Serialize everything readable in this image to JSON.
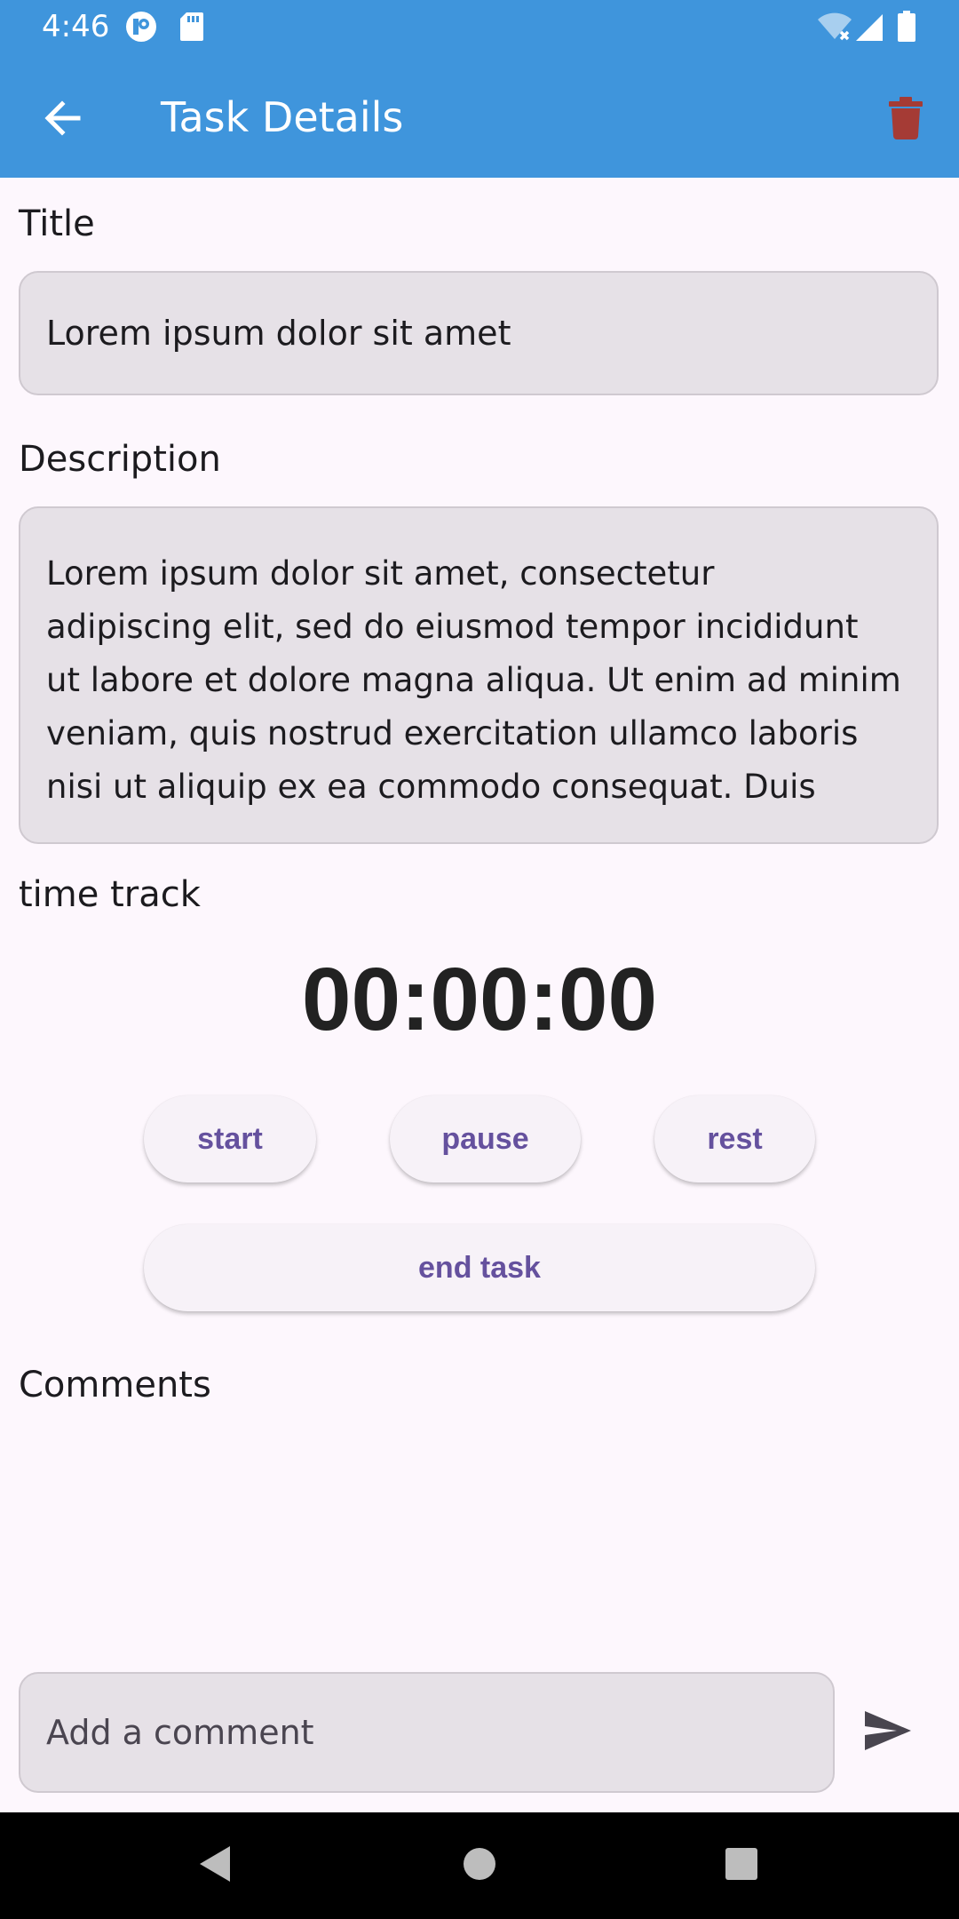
{
  "status_bar": {
    "time": "4:46",
    "icons": [
      "p-badge-icon",
      "sd-card-icon",
      "wifi-off-icon",
      "signal-icon",
      "battery-icon"
    ]
  },
  "app_bar": {
    "title": "Task Details",
    "back_icon": "arrow-back-icon",
    "delete_icon": "trash-icon",
    "delete_color": "#a53b35",
    "background_color": "#3f95dc"
  },
  "title_section": {
    "label": "Title",
    "value": "Lorem ipsum dolor sit amet"
  },
  "description_section": {
    "label": "Description",
    "value": "Lorem ipsum dolor sit amet, consectetur\nadipiscing elit, sed do eiusmod tempor incididunt\nut labore et dolore magna aliqua. Ut enim ad minim\nveniam, quis nostrud exercitation ullamco laboris\nnisi ut aliquip ex ea commodo consequat. Duis"
  },
  "time_track": {
    "label": "time track",
    "timer": "00:00:00",
    "buttons": {
      "start": "start",
      "pause": "pause",
      "rest": "rest",
      "end_task": "end task"
    },
    "button_text_color": "#65519e"
  },
  "comments": {
    "label": "Comments",
    "input_placeholder": "Add a comment",
    "send_icon": "send-icon"
  },
  "nav_bar": {
    "buttons": [
      "back-triangle-icon",
      "home-circle-icon",
      "recents-square-icon"
    ]
  }
}
